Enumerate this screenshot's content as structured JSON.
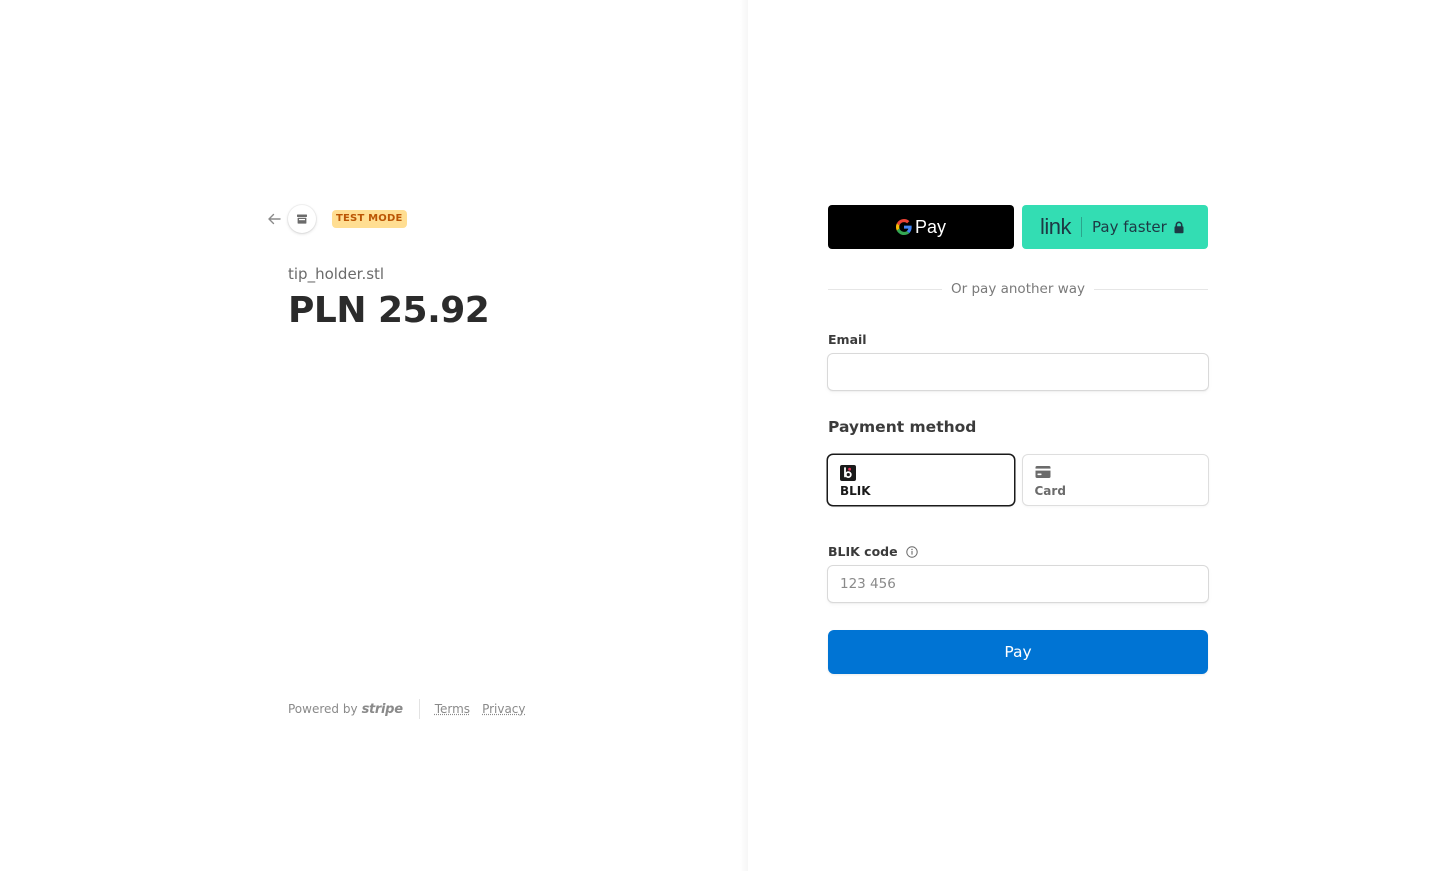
{
  "header": {
    "test_badge": "TEST MODE"
  },
  "product": {
    "name": "tip_holder.stl",
    "price": "PLN 25.92"
  },
  "footer": {
    "powered_by": "Powered by",
    "stripe": "stripe",
    "terms": "Terms",
    "privacy": "Privacy"
  },
  "wallets": {
    "gpay_label": "Pay",
    "link_logo": "link",
    "link_label": "Pay faster"
  },
  "divider_text": "Or pay another way",
  "email": {
    "label": "Email",
    "value": "",
    "placeholder": ""
  },
  "payment_method": {
    "title": "Payment method",
    "options": [
      {
        "label": "BLIK",
        "selected": true,
        "icon": "blik-icon"
      },
      {
        "label": "Card",
        "selected": false,
        "icon": "card-icon"
      }
    ]
  },
  "blik": {
    "label": "BLIK code",
    "placeholder": "123 456"
  },
  "pay_button": "Pay",
  "colors": {
    "pay_button": "#0074d4",
    "link_button": "#33ddb3",
    "test_badge_bg": "#ffde92",
    "test_badge_text": "#bb5504"
  }
}
